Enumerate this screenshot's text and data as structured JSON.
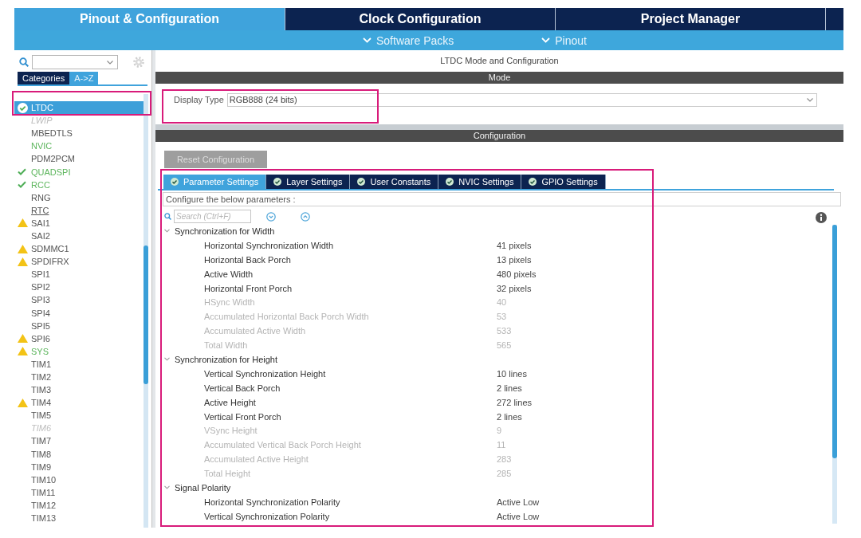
{
  "top_tabs": [
    {
      "label": "Pinout & Configuration",
      "selected": true
    },
    {
      "label": "Clock Configuration",
      "selected": false
    },
    {
      "label": "Project Manager",
      "selected": false
    }
  ],
  "sub_menu": [
    "Software Packs",
    "Pinout"
  ],
  "sidebar": {
    "tabs": [
      {
        "label": "Categories",
        "selected": false
      },
      {
        "label": "A->Z",
        "selected": true
      }
    ],
    "items": [
      {
        "label": "LTDC",
        "selected": true,
        "ok": true,
        "warning": false,
        "configured": false,
        "disabled": false,
        "hovered": false
      },
      {
        "label": "LWIP",
        "selected": false,
        "ok": false,
        "warning": false,
        "configured": false,
        "disabled": true,
        "hovered": false
      },
      {
        "label": "MBEDTLS",
        "selected": false,
        "ok": false,
        "warning": false,
        "configured": false,
        "disabled": false,
        "hovered": false
      },
      {
        "label": "NVIC",
        "selected": false,
        "ok": false,
        "warning": false,
        "configured": true,
        "disabled": false,
        "hovered": false
      },
      {
        "label": "PDM2PCM",
        "selected": false,
        "ok": false,
        "warning": false,
        "configured": false,
        "disabled": false,
        "hovered": false
      },
      {
        "label": "QUADSPI",
        "selected": false,
        "ok": true,
        "warning": false,
        "configured": true,
        "disabled": false,
        "hovered": false
      },
      {
        "label": "RCC",
        "selected": false,
        "ok": true,
        "warning": false,
        "configured": true,
        "disabled": false,
        "hovered": false
      },
      {
        "label": "RNG",
        "selected": false,
        "ok": false,
        "warning": false,
        "configured": false,
        "disabled": false,
        "hovered": false
      },
      {
        "label": "RTC",
        "selected": false,
        "ok": false,
        "warning": false,
        "configured": false,
        "disabled": false,
        "hovered": true
      },
      {
        "label": "SAI1",
        "selected": false,
        "ok": false,
        "warning": true,
        "configured": false,
        "disabled": false,
        "hovered": false
      },
      {
        "label": "SAI2",
        "selected": false,
        "ok": false,
        "warning": false,
        "configured": false,
        "disabled": false,
        "hovered": false
      },
      {
        "label": "SDMMC1",
        "selected": false,
        "ok": false,
        "warning": true,
        "configured": false,
        "disabled": false,
        "hovered": false
      },
      {
        "label": "SPDIFRX",
        "selected": false,
        "ok": false,
        "warning": true,
        "configured": false,
        "disabled": false,
        "hovered": false
      },
      {
        "label": "SPI1",
        "selected": false,
        "ok": false,
        "warning": false,
        "configured": false,
        "disabled": false,
        "hovered": false
      },
      {
        "label": "SPI2",
        "selected": false,
        "ok": false,
        "warning": false,
        "configured": false,
        "disabled": false,
        "hovered": false
      },
      {
        "label": "SPI3",
        "selected": false,
        "ok": false,
        "warning": false,
        "configured": false,
        "disabled": false,
        "hovered": false
      },
      {
        "label": "SPI4",
        "selected": false,
        "ok": false,
        "warning": false,
        "configured": false,
        "disabled": false,
        "hovered": false
      },
      {
        "label": "SPI5",
        "selected": false,
        "ok": false,
        "warning": false,
        "configured": false,
        "disabled": false,
        "hovered": false
      },
      {
        "label": "SPI6",
        "selected": false,
        "ok": false,
        "warning": true,
        "configured": false,
        "disabled": false,
        "hovered": false
      },
      {
        "label": "SYS",
        "selected": false,
        "ok": false,
        "warning": true,
        "configured": true,
        "disabled": false,
        "hovered": false
      },
      {
        "label": "TIM1",
        "selected": false,
        "ok": false,
        "warning": false,
        "configured": false,
        "disabled": false,
        "hovered": false
      },
      {
        "label": "TIM2",
        "selected": false,
        "ok": false,
        "warning": false,
        "configured": false,
        "disabled": false,
        "hovered": false
      },
      {
        "label": "TIM3",
        "selected": false,
        "ok": false,
        "warning": false,
        "configured": false,
        "disabled": false,
        "hovered": false
      },
      {
        "label": "TIM4",
        "selected": false,
        "ok": false,
        "warning": true,
        "configured": false,
        "disabled": false,
        "hovered": false
      },
      {
        "label": "TIM5",
        "selected": false,
        "ok": false,
        "warning": false,
        "configured": false,
        "disabled": false,
        "hovered": false
      },
      {
        "label": "TIM6",
        "selected": false,
        "ok": false,
        "warning": false,
        "configured": false,
        "disabled": true,
        "hovered": false
      },
      {
        "label": "TIM7",
        "selected": false,
        "ok": false,
        "warning": false,
        "configured": false,
        "disabled": false,
        "hovered": false
      },
      {
        "label": "TIM8",
        "selected": false,
        "ok": false,
        "warning": false,
        "configured": false,
        "disabled": false,
        "hovered": false
      },
      {
        "label": "TIM9",
        "selected": false,
        "ok": false,
        "warning": false,
        "configured": false,
        "disabled": false,
        "hovered": false
      },
      {
        "label": "TIM10",
        "selected": false,
        "ok": false,
        "warning": false,
        "configured": false,
        "disabled": false,
        "hovered": false
      },
      {
        "label": "TIM11",
        "selected": false,
        "ok": false,
        "warning": false,
        "configured": false,
        "disabled": false,
        "hovered": false
      },
      {
        "label": "TIM12",
        "selected": false,
        "ok": false,
        "warning": false,
        "configured": false,
        "disabled": false,
        "hovered": false
      },
      {
        "label": "TIM13",
        "selected": false,
        "ok": false,
        "warning": false,
        "configured": false,
        "disabled": false,
        "hovered": false
      }
    ]
  },
  "panel": {
    "title": "LTDC Mode and Configuration",
    "mode": {
      "header": "Mode",
      "fields": [
        {
          "label": "Display Type",
          "value": "RGB888 (24 bits)"
        }
      ]
    },
    "configuration": {
      "header": "Configuration",
      "reset_button": {
        "label": "Reset Configuration",
        "disabled": true
      },
      "tabs": [
        {
          "label": "Parameter Settings",
          "selected": true
        },
        {
          "label": "Layer Settings",
          "selected": false
        },
        {
          "label": "User Constants",
          "selected": false
        },
        {
          "label": "NVIC Settings",
          "selected": false
        },
        {
          "label": "GPIO Settings",
          "selected": false
        }
      ],
      "hint": "Configure the below parameters :",
      "search": {
        "placeholder": "Search (Ctrl+F)"
      },
      "groups": [
        {
          "title": "Synchronization for Width",
          "expanded": true,
          "children": [
            {
              "label": "Horizontal Synchronization Width",
              "value": "41 pixels",
              "disabled": false
            },
            {
              "label": "Horizontal Back Porch",
              "value": "13 pixels",
              "disabled": false
            },
            {
              "label": "Active Width",
              "value": "480 pixels",
              "disabled": false
            },
            {
              "label": "Horizontal Front Porch",
              "value": "32 pixels",
              "disabled": false
            },
            {
              "label": "HSync Width",
              "value": "40",
              "disabled": true
            },
            {
              "label": "Accumulated Horizontal Back Porch Width",
              "value": "53",
              "disabled": true
            },
            {
              "label": "Accumulated Active Width",
              "value": "533",
              "disabled": true
            },
            {
              "label": "Total Width",
              "value": "565",
              "disabled": true
            }
          ]
        },
        {
          "title": "Synchronization for Height",
          "expanded": true,
          "children": [
            {
              "label": "Vertical Synchronization Height",
              "value": "10 lines",
              "disabled": false
            },
            {
              "label": "Vertical Back Porch",
              "value": "2 lines",
              "disabled": false
            },
            {
              "label": "Active Height",
              "value": "272 lines",
              "disabled": false
            },
            {
              "label": "Vertical Front Porch",
              "value": "2 lines",
              "disabled": false
            },
            {
              "label": "VSync Height",
              "value": "9",
              "disabled": true
            },
            {
              "label": "Accumulated Vertical Back Porch Height",
              "value": "11",
              "disabled": true
            },
            {
              "label": "Accumulated Active Height",
              "value": "283",
              "disabled": true
            },
            {
              "label": "Total Height",
              "value": "285",
              "disabled": true
            }
          ]
        },
        {
          "title": "Signal Polarity",
          "expanded": true,
          "children": [
            {
              "label": "Horizontal Synchronization Polarity",
              "value": "Active Low",
              "disabled": false
            },
            {
              "label": "Vertical Synchronization Polarity",
              "value": "Active Low",
              "disabled": false
            }
          ]
        }
      ]
    }
  }
}
